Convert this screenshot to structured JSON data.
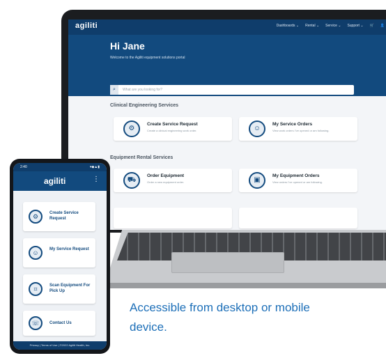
{
  "desktop": {
    "logo": "agiliti",
    "nav": [
      "Dashboards ⌄",
      "Rental ⌄",
      "Service ⌄",
      "Support ⌄",
      "🛒",
      "👤"
    ],
    "greeting": "Hi Jane",
    "welcome": "Welcome to the Agiliti equipment solutions portal",
    "search_placeholder": "What are you looking for?",
    "sections": {
      "clinical": "Clinical Engineering Services",
      "rental": "Equipment Rental Services"
    },
    "cards": [
      {
        "title": "Create Service Request",
        "subtitle": "Create a clinical engineering work order.",
        "icon": "wrench-gear-icon"
      },
      {
        "title": "My Service Orders",
        "subtitle": "View work orders I’ve opened or am following.",
        "icon": "technician-icon"
      },
      {
        "title": "Order Equipment",
        "subtitle": "Order a new equipment order.",
        "icon": "equipment-truck-icon"
      },
      {
        "title": "My Equipment Orders",
        "subtitle": "View orders I’ve opened or am following.",
        "icon": "package-icon"
      }
    ]
  },
  "mobile": {
    "time": "2:40",
    "status_icons": "▾◆▲▮",
    "logo": "agiliti",
    "menu_icon": "⋮",
    "cards": [
      {
        "label": "Create Service Request",
        "icon": "wrench-gear-icon"
      },
      {
        "label": "My Service Request",
        "icon": "technician-icon"
      },
      {
        "label": "Scan Equipment For Pick Up",
        "icon": "scan-icon"
      },
      {
        "label": "Contact Us",
        "icon": "support-agent-icon"
      }
    ],
    "footer": "Privacy | Terms of Use | ©2022 Agiliti Health, Inc."
  },
  "caption": "Accessible from desktop or mobile device."
}
